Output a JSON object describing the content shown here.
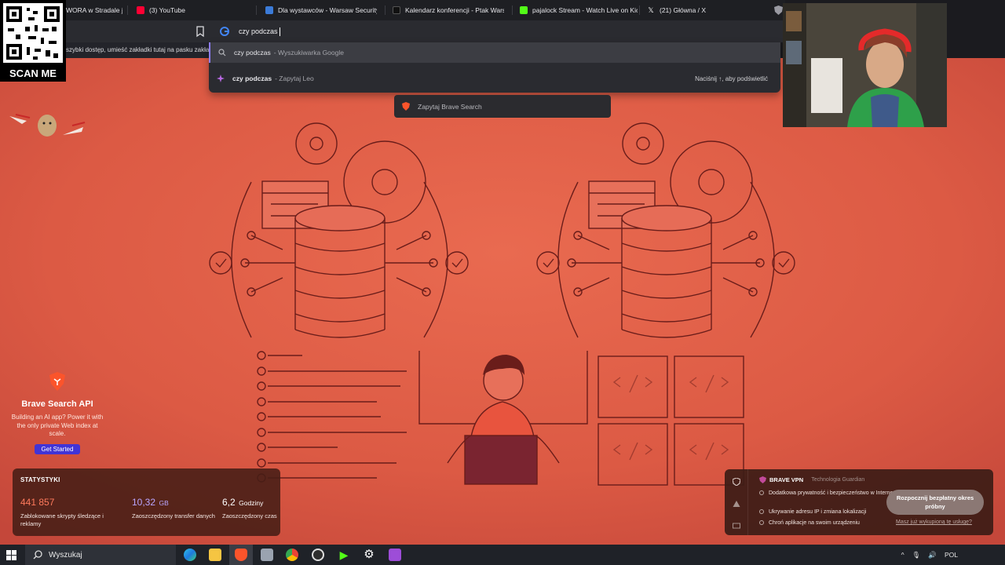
{
  "browser": {
    "tabs": [
      {
        "title": "WORA w Stradale je",
        "favicon_color": "#f2c200"
      },
      {
        "title": "(3) YouTube",
        "favicon_color": "#ff0033"
      },
      {
        "title": "Dla wystawców - Warsaw Security &",
        "favicon_color": "#3b7bd8"
      },
      {
        "title": "Kalendarz konferencji - Ptak Warsaw",
        "favicon_color": "#111111"
      },
      {
        "title": "pajalock Stream - Watch Live on Kick",
        "favicon_color": "#53fc18"
      },
      {
        "title": "(21) Główna / X",
        "favicon_color": "#ffffff"
      }
    ],
    "bookmarks_hint": "szybki dostęp, umieść zakładki tutaj na pasku zakład",
    "omnibox": {
      "value": "czy podczas"
    },
    "suggestions": [
      {
        "query": "czy podczas",
        "source": "- Wyszukiwarka Google",
        "icon": "search-icon"
      },
      {
        "query": "czy podczas",
        "source": "- Zapytaj Leo",
        "icon": "leo-icon",
        "hint": "Naciśnij ↑, aby podświetlić"
      }
    ],
    "brave_search_pill": "Zapytaj Brave Search"
  },
  "overlay": {
    "qr_label": "SCAN ME"
  },
  "api_card": {
    "title": "Brave Search API",
    "description": "Building an AI app? Power it with the only private Web index at scale.",
    "button": "Get Started"
  },
  "stats": {
    "heading": "STATYSTYKI",
    "items": [
      {
        "value": "441 857",
        "unit": "",
        "label": "Zablokowane skrypty śledzące i reklamy",
        "color": "#ff7a5c"
      },
      {
        "value": "10,32",
        "unit": "GB",
        "label": "Zaoszczędzony transfer danych",
        "color": "#b9a6ff"
      },
      {
        "value": "6,2",
        "unit": "Godziny",
        "label": "Zaoszczędzony czas",
        "color": "#ffffff"
      }
    ]
  },
  "vpn": {
    "brand": "BRAVE VPN",
    "tech": "Technologia  Guardian",
    "items": [
      "Dodatkowa prywatność i bezpieczeństwo w Internecie",
      "Ukrywanie adresu IP i zmiana lokalizacji",
      "Chroń aplikacje na swoim urządzeniu"
    ],
    "cta": "Rozpocznij bezpłatny okres próbny",
    "link": "Masz już wykupioną tę usługę?"
  },
  "taskbar": {
    "search_placeholder": "Wyszukaj",
    "language": "POL",
    "icons": [
      "edge-icon",
      "file-explorer-icon",
      "brave-icon",
      "app-icon",
      "chrome-icon",
      "obs-icon",
      "kick-icon",
      "settings-icon",
      "game-icon"
    ]
  },
  "colors": {
    "hero_bg": "#e0604a",
    "line": "#6a1d1a",
    "accent_purple": "#4134d6"
  }
}
